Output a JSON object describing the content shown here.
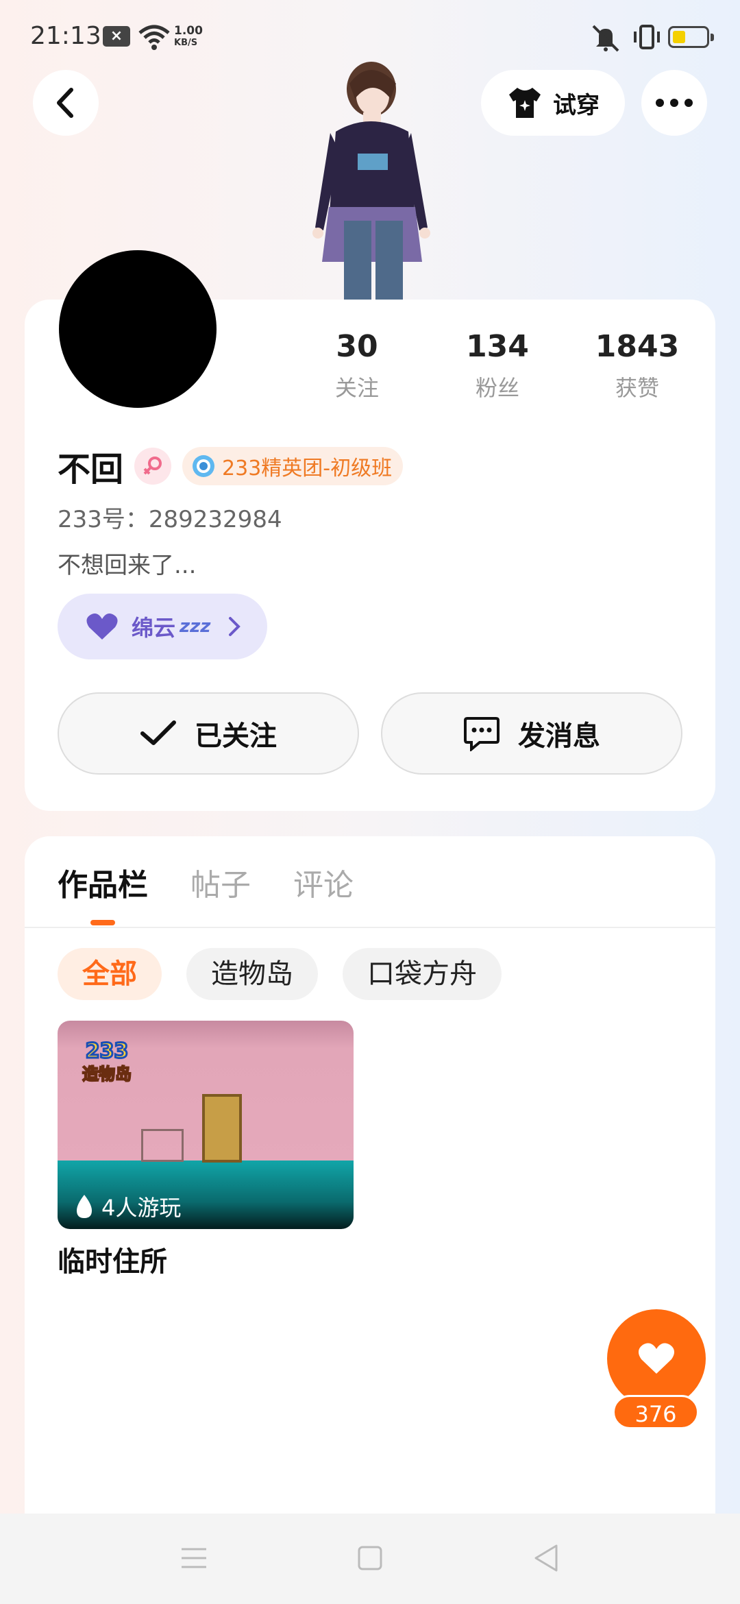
{
  "status_bar": {
    "time": "21:13",
    "notification_icon": "×",
    "net_speed_value": "1.00",
    "net_speed_unit": "KB/S",
    "battery_level": 0.25,
    "battery_color": "#f4d000"
  },
  "header": {
    "back_icon": "chevron-left-icon",
    "try_on_label": "试穿",
    "more_icon": "more-horizontal-icon"
  },
  "profile": {
    "stats": [
      {
        "value": "30",
        "label": "关注"
      },
      {
        "value": "134",
        "label": "粉丝"
      },
      {
        "value": "1843",
        "label": "获赞"
      }
    ],
    "name": "不回",
    "gender_icon": "female-icon",
    "badge_label": "233精英团-初级班",
    "uid": "233号：289232984",
    "bio": "不想回来了...",
    "mood_label": "绵云",
    "mood_zzz": "zzz",
    "follow_label": "已关注",
    "message_label": "发消息"
  },
  "works": {
    "tabs": [
      {
        "label": "作品栏",
        "active": true
      },
      {
        "label": "帖子",
        "active": false
      },
      {
        "label": "评论",
        "active": false
      }
    ],
    "filters": [
      {
        "label": "全部",
        "active": true
      },
      {
        "label": "造物岛",
        "active": false
      },
      {
        "label": "口袋方舟",
        "active": false
      }
    ],
    "games": [
      {
        "logo_text": "233",
        "logo_sub": "造物岛",
        "plays": "4人游玩",
        "title": "临时住所"
      }
    ]
  },
  "like": {
    "count": "376"
  },
  "colors": {
    "accent": "#ff6a0f",
    "badge_text": "#ef7a24",
    "mood_text": "#6b59c9"
  }
}
